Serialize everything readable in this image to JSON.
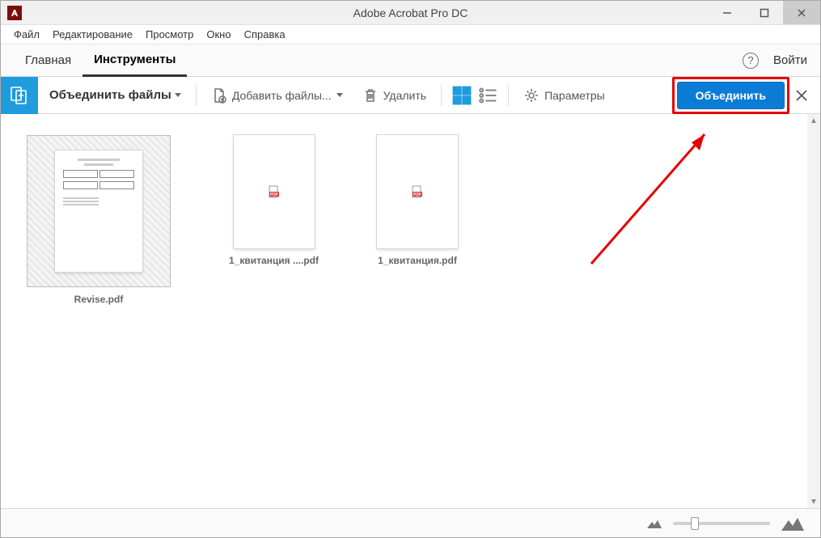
{
  "window": {
    "title": "Adobe Acrobat Pro DC"
  },
  "menu": {
    "file": "Файл",
    "edit": "Редактирование",
    "view": "Просмотр",
    "window": "Окно",
    "help": "Справка"
  },
  "nav": {
    "home": "Главная",
    "tools": "Инструменты",
    "login": "Войти",
    "help_glyph": "?"
  },
  "toolbar": {
    "combine_title": "Объединить файлы",
    "add_files": "Добавить файлы...",
    "delete": "Удалить",
    "options": "Параметры",
    "combine_btn": "Объединить"
  },
  "files": [
    {
      "name": "Revise.pdf",
      "selected": true,
      "has_preview": true
    },
    {
      "name": "1_квитанция ....pdf",
      "selected": false,
      "has_preview": false
    },
    {
      "name": "1_квитанция.pdf",
      "selected": false,
      "has_preview": false
    }
  ]
}
